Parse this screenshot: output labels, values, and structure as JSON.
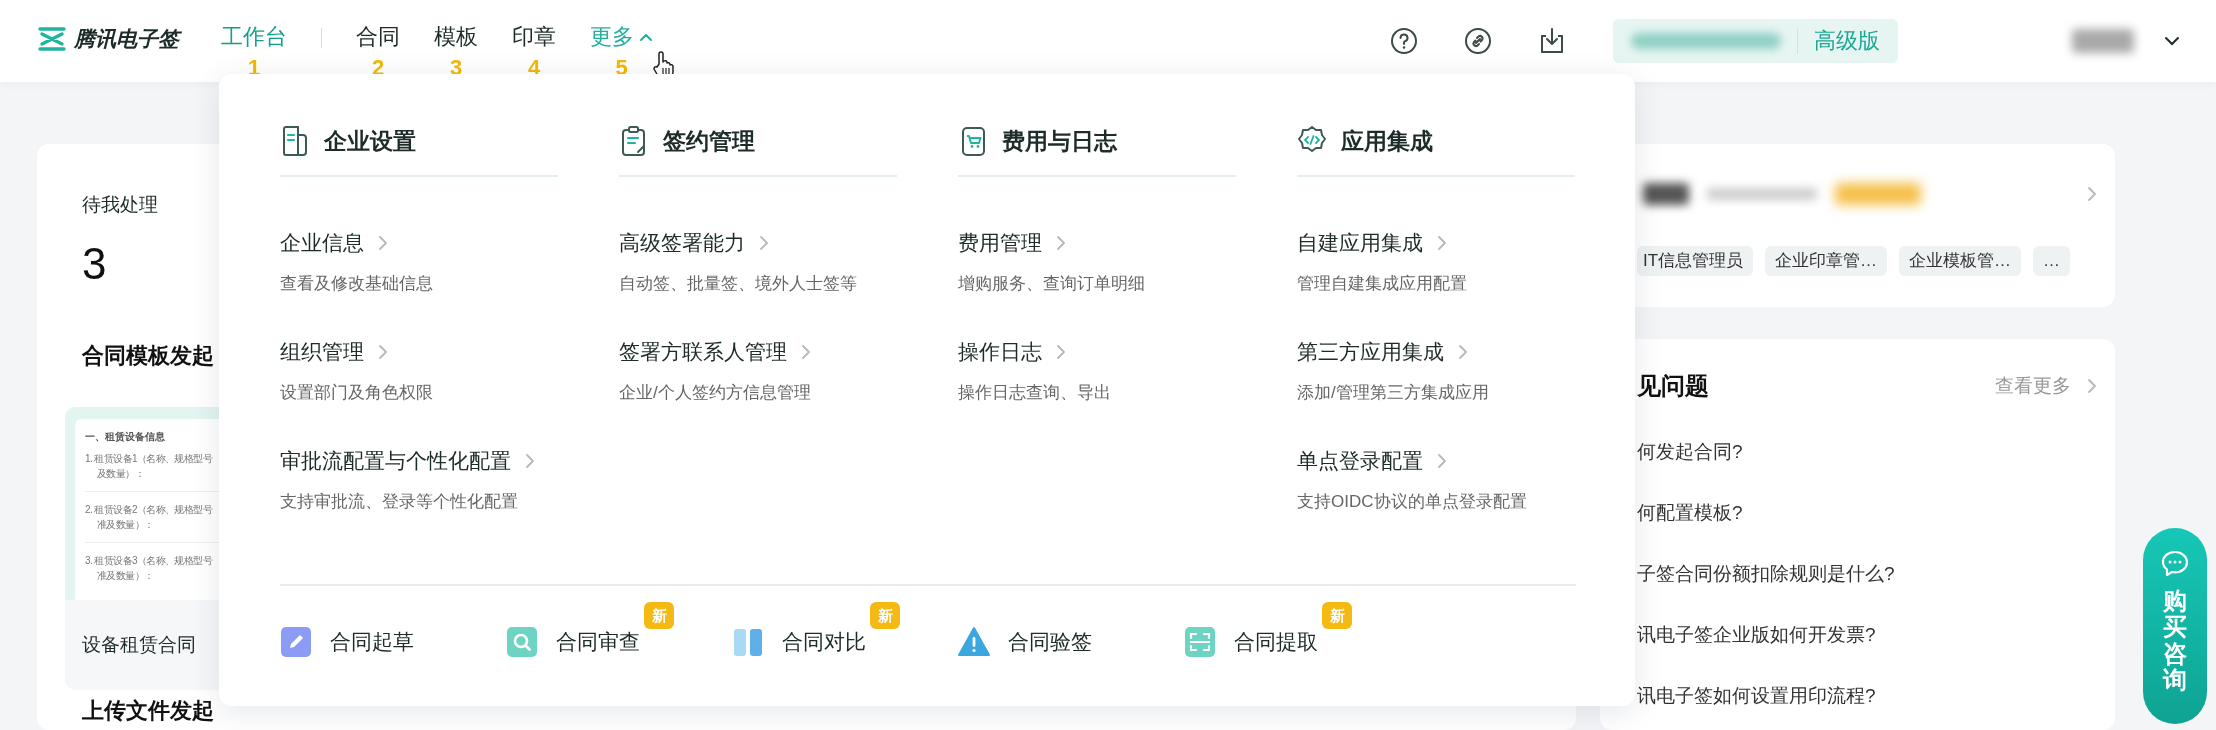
{
  "header": {
    "logo": "腾讯电子签",
    "nav": [
      {
        "label": "工作台",
        "marker": "1",
        "kind": "link",
        "selected": true
      },
      {
        "label": "合同",
        "marker": "2",
        "kind": "link",
        "selected": false
      },
      {
        "label": "模板",
        "marker": "3",
        "kind": "link",
        "selected": false
      },
      {
        "label": "印章",
        "marker": "4",
        "kind": "link",
        "selected": false
      },
      {
        "label": "更多",
        "marker": "5",
        "kind": "dropdown",
        "selected": false,
        "expanded": true
      }
    ],
    "plan": "高级版"
  },
  "workbench": {
    "todo": {
      "label": "待我处理",
      "count": "3"
    },
    "template_section": {
      "title": "合同模板发起",
      "template": {
        "preview_heading": "一、租赁设备信息",
        "preview_items": [
          {
            "line": "1. 租赁设备1（名称、规格型号",
            "continuation": "及数量）："
          },
          {
            "line": "2. 租赁设备2（名称、规格型号",
            "continuation": "准及数量）："
          },
          {
            "line": "3. 租赁设备3（名称、规格型号",
            "continuation": "准及数量）："
          }
        ],
        "name": "设备租赁合同"
      }
    },
    "upload_section": {
      "title": "上传文件发起"
    }
  },
  "account_card": {
    "roles": [
      "IT信息管理员",
      "企业印章管…",
      "企业模板管…",
      "…"
    ]
  },
  "faq": {
    "title": "见问题",
    "more": "查看更多",
    "questions": [
      "何发起合同?",
      "何配置模板?",
      "子签合同份额扣除规则是什么?",
      "讯电子签企业版如何开发票?",
      "讯电子签如何设置用印流程?"
    ]
  },
  "more_menu": {
    "sections": [
      {
        "title": "企业设置",
        "items": [
          {
            "title": "企业信息",
            "desc": "查看及修改基础信息"
          },
          {
            "title": "组织管理",
            "desc": "设置部门及角色权限"
          },
          {
            "title": "审批流配置与个性化配置",
            "desc": "支持审批流、登录等个性化配置"
          }
        ]
      },
      {
        "title": "签约管理",
        "items": [
          {
            "title": "高级签署能力",
            "desc": "自动签、批量签、境外人士签等"
          },
          {
            "title": "签署方联系人管理",
            "desc": "企业/个人签约方信息管理"
          }
        ]
      },
      {
        "title": "费用与日志",
        "items": [
          {
            "title": "费用管理",
            "desc": "增购服务、查询订单明细"
          },
          {
            "title": "操作日志",
            "desc": "操作日志查询、导出"
          }
        ]
      },
      {
        "title": "应用集成",
        "items": [
          {
            "title": "自建应用集成",
            "desc": "管理自建集成应用配置"
          },
          {
            "title": "第三方应用集成",
            "desc": "添加/管理第三方集成应用"
          },
          {
            "title": "单点登录配置",
            "desc": "支持OIDC协议的单点登录配置"
          }
        ]
      }
    ],
    "tools": [
      {
        "label": "合同起草"
      },
      {
        "label": "合同审查",
        "badge": "新"
      },
      {
        "label": "合同对比",
        "badge": "新"
      },
      {
        "label": "合同验签"
      },
      {
        "label": "合同提取",
        "badge": "新"
      }
    ]
  },
  "consult_button": {
    "label": "购买咨询"
  }
}
